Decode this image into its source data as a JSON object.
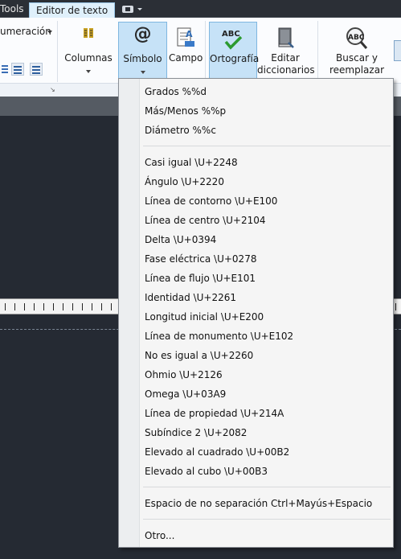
{
  "top_tabs": {
    "tools_label": "Tools",
    "active_tab_label": "Editor de texto"
  },
  "ribbon": {
    "numbering_label": "umeración",
    "buttons": {
      "columns": "Columnas",
      "symbol": "Símbolo",
      "field": "Campo",
      "spelling": "Ortografía",
      "edit_dictionaries": "Editar diccionarios",
      "find_replace": "Buscar y reemplazar"
    },
    "icon_text": {
      "spell_abc": "ABC",
      "find_abc": "ABC",
      "symbol_glyph": "@"
    }
  },
  "symbol_menu": {
    "group1": [
      "Grados   %%d",
      "Más/Menos   %%p",
      "Diámetro   %%c"
    ],
    "group2": [
      "Casi igual   \\U+2248",
      "Ángulo   \\U+2220",
      "Línea de contorno   \\U+E100",
      "Línea de centro   \\U+2104",
      "Delta   \\U+0394",
      "Fase eléctrica   \\U+0278",
      "Línea de flujo   \\U+E101",
      "Identidad   \\U+2261",
      "Longitud inicial   \\U+E200",
      "Línea de monumento   \\U+E102",
      "No es igual a   \\U+2260",
      "Ohmio   \\U+2126",
      "Omega   \\U+03A9",
      "Línea de propiedad   \\U+214A",
      "Subíndice 2   \\U+2082",
      "Elevado al cuadrado   \\U+00B2",
      "Elevado al cubo   \\U+00B3"
    ],
    "group3": [
      "Espacio de no separación Ctrl+Mayús+Espacio"
    ],
    "group4": [
      "Otro..."
    ]
  },
  "colors": {
    "accent": "#c6e2f7",
    "active_tab": "#dff0fb",
    "canvas": "#252a33"
  }
}
